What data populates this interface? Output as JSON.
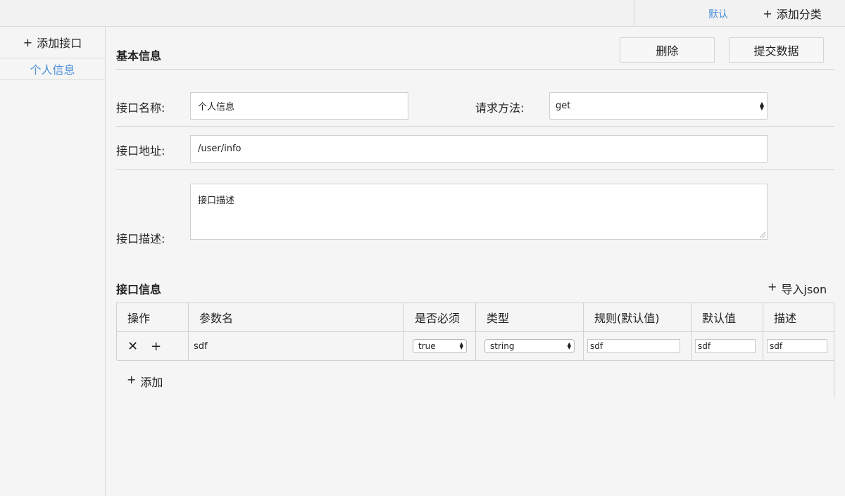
{
  "topbar": {
    "default_tab": "默认",
    "add_category": "添加分类",
    "plus": "+"
  },
  "sidebar": {
    "add_api": "添加接口",
    "plus": "+",
    "items": [
      {
        "label": "个人信息"
      }
    ]
  },
  "basic_info": {
    "title": "基本信息",
    "delete_label": "删除",
    "submit_label": "提交数据",
    "name_label": "接口名称:",
    "name_value": "个人信息",
    "method_label": "请求方法:",
    "method_value": "get",
    "url_label": "接口地址:",
    "url_value": "/user/info",
    "desc_label": "接口描述:",
    "desc_value": "接口描述"
  },
  "api_info": {
    "title": "接口信息",
    "import_json": "导入json",
    "plus": "+",
    "columns": [
      "操作",
      "参数名",
      "是否必须",
      "类型",
      "规则(默认值)",
      "默认值",
      "描述"
    ],
    "rows": [
      {
        "remove_icon": "✕",
        "add_icon": "+",
        "param_name": "sdf",
        "required": "true",
        "type": "string",
        "rule": "sdf",
        "default": "sdf",
        "description": "sdf"
      }
    ],
    "add_row_label": "添加"
  },
  "colors": {
    "accent": "#4a90d9",
    "background": "#f5f5f5",
    "border": "#d0d0d0"
  }
}
